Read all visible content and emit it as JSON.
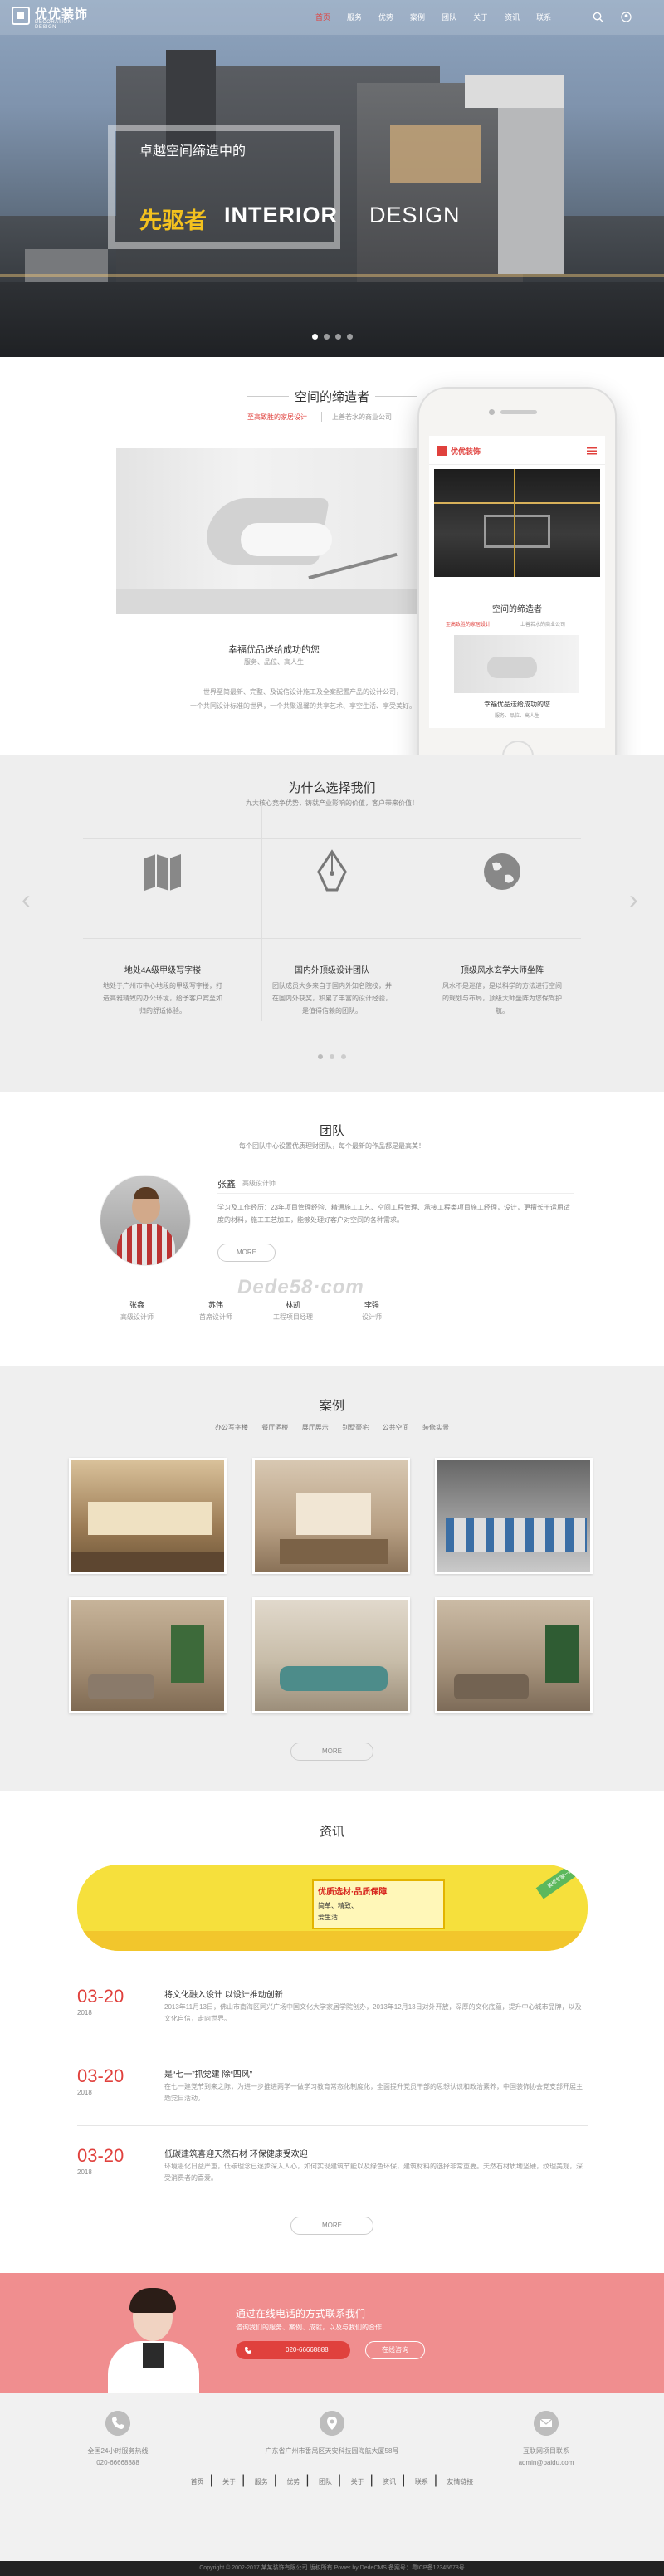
{
  "header": {
    "logo_main": "优优装饰",
    "logo_sub": "DECORATION DESIGN",
    "nav": [
      "首页",
      "服务",
      "优势",
      "案例",
      "团队",
      "关于",
      "资讯",
      "联系"
    ]
  },
  "hero": {
    "sub": "卓越空间缔造中的",
    "big_cn": "先驱者",
    "big_en_bold": "INTERIOR",
    "big_en_light": "DESIGN"
  },
  "about": {
    "title": "空间的缔造者",
    "tabs": [
      "至高致胜的家居设计",
      "上善若水的商业公司"
    ],
    "caption": "幸福优品送给成功的您",
    "caption_sub": "服务、品位、高人生",
    "desc": [
      "世界至简最新、完整、及诚信设计施工及全案配置产品的设计公司，",
      "一个共同设计标准的世界，一个共聚温馨的共享艺术、享空生活、享受美好。"
    ]
  },
  "phone": {
    "logo": "优优装饰",
    "title": "空间的缔造者",
    "tabs": [
      "至高致胜的家居设计",
      "上善若水的商业公司"
    ],
    "caption": "幸福优品送给成功的您",
    "caption_sub": "服务、品位、高人生"
  },
  "why": {
    "title": "为什么选择我们",
    "sub": "九大核心竞争优势，铸就产业影响的价值，客户带来价值！",
    "items": [
      {
        "title": "地处4A级甲级写字楼",
        "desc": "地处于广州市中心地段的甲级写字楼，打造高雅精致的办公环境，给予客户宾至如归的舒适体验。"
      },
      {
        "title": "国内外顶级设计团队",
        "desc": "团队成员大多来自于国内外知名院校，并在国内外获奖，积累了丰富的设计经验，是值得信赖的团队。"
      },
      {
        "title": "顶级风水玄学大师坐阵",
        "desc": "风水不是迷信，是以科学的方法进行空间的规划与布局，顶级大师坐阵为您保驾护航。"
      }
    ]
  },
  "team": {
    "title": "团队",
    "sub": "每个团队中心设置优质理财团队，每个最新的作品都是最高美！",
    "lead_name": "张鑫",
    "lead_role": "高级设计师",
    "lead_desc": "学习及工作经历：23年项目管理经验、精通施工工艺、空间工程管理、承接工程类项目施工经理，设计，更擅长于运用适度的材料，施工工艺加工，能够处理好客户对空间的各种需求。",
    "more": "MORE",
    "members": [
      {
        "name": "张鑫",
        "role": "高级设计师"
      },
      {
        "name": "苏伟",
        "role": "首席设计师"
      },
      {
        "name": "林凯",
        "role": "工程项目经理"
      },
      {
        "name": "李强",
        "role": "设计师"
      }
    ],
    "watermark": "Dede58·com"
  },
  "cases": {
    "title": "案例",
    "tabs": [
      "办公写字楼",
      "餐厅酒楼",
      "展厅展示",
      "别墅豪宅",
      "公共空间",
      "装修实景"
    ],
    "more": "MORE"
  },
  "news": {
    "title": "资讯",
    "banner_title": "优质选材·品质保障",
    "banner_sub1": "简单、精致、",
    "banner_sub2": "爱生活",
    "banner_badge": "装修专家一站式服务",
    "items": [
      {
        "date": "03-20",
        "year": "2018",
        "title": "将文化融入设计 以设计推动创新",
        "desc": "2013年11月13日，佛山市南海区同兴广场中国文化大学家居学院创办，2013年12月13日对外开放，深厚的文化底蕴，提升中心城市品牌，以及文化自信，走向世界。"
      },
      {
        "date": "03-20",
        "year": "2018",
        "title": "是“七一”抓党建 除“四风”",
        "desc": "在七一建党节到来之际，为进一步推进两学一做学习教育常态化制度化，全面提升党员干部的思想认识和政治素养，中国装饰协会党支部开展主题党日活动。"
      },
      {
        "date": "03-20",
        "year": "2018",
        "title": "低碳建筑喜迎天然石材 环保健康受欢迎",
        "desc": "环境恶化日益严重，低碳理念已逐步深入人心，如何实现建筑节能以及绿色环保，建筑材料的选择非常重要。天然石材质地坚硬，纹理美观，深受消费者的喜爱。"
      }
    ],
    "more": "MORE"
  },
  "contact": {
    "title": "通过在线电话的方式联系我们",
    "sub": "咨询我们的服务、案例、成就，以及与我们的合作",
    "btn_phone": "020-66668888",
    "btn_online": "在线咨询"
  },
  "footer": {
    "cols": [
      {
        "lines": [
          "全国24小时服务热线",
          "020-66668888"
        ]
      },
      {
        "lines": [
          "广东省广州市番禺区天安科技园海航大厦58号"
        ]
      },
      {
        "lines": [
          "互联网项目联系",
          "admin@baidu.com"
        ]
      }
    ],
    "links": [
      "首页",
      "关于",
      "服务",
      "优势",
      "团队",
      "关于",
      "资讯",
      "联系",
      "友情链接"
    ],
    "copyright": "Copyright © 2002-2017 某某装饰有限公司 版权所有 Power by DedeCMS 备案号：粤ICP备12345678号"
  },
  "colors": {
    "accent": "#e0413d",
    "gold": "#f4c21e",
    "pink": "#f08e8f"
  }
}
